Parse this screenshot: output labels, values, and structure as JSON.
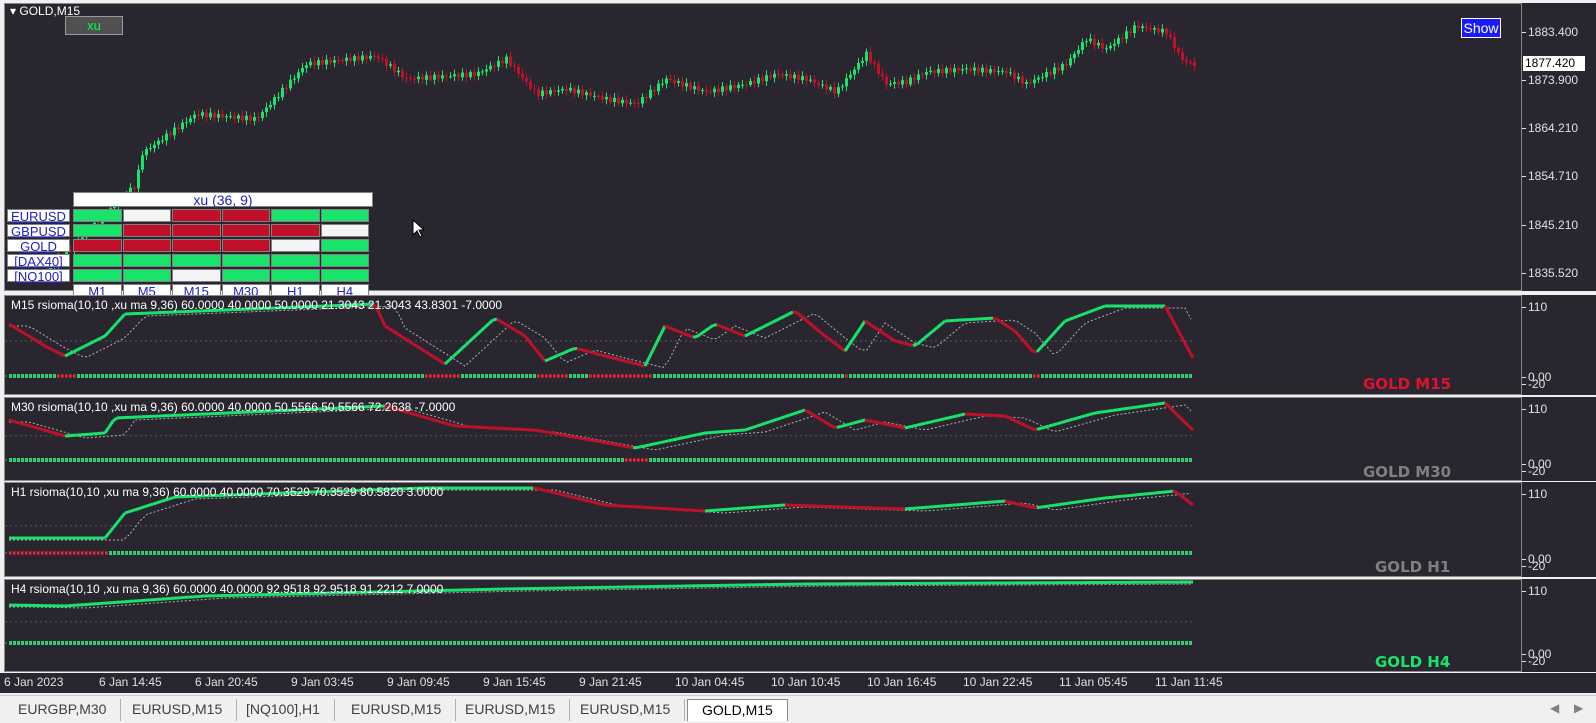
{
  "main_chart": {
    "symbol_label": "GOLD,M15",
    "xu_button": "xu",
    "show_button": "Show",
    "current_price": "1877.420",
    "price_ticks": [
      "1883.400",
      "1873.900",
      "1864.210",
      "1854.710",
      "1845.210",
      "1835.520"
    ]
  },
  "grid": {
    "title": "xu (36, 9)",
    "rows": [
      "EURUSD",
      "GBPUSD",
      "GOLD",
      "[DAX40]",
      "[NQ100]"
    ],
    "cols": [
      "M1",
      "M5",
      "M15",
      "M30",
      "H1",
      "H4"
    ],
    "cells": [
      [
        "green",
        "white",
        "red",
        "red",
        "green",
        "green"
      ],
      [
        "green",
        "red",
        "red",
        "red",
        "red",
        "white"
      ],
      [
        "red",
        "red",
        "red",
        "red",
        "white",
        "green"
      ],
      [
        "green",
        "green",
        "green",
        "green",
        "green",
        "green"
      ],
      [
        "green",
        "green",
        "white",
        "green",
        "green",
        "green"
      ]
    ],
    "colors": {
      "green": "#19e36b",
      "red": "#c0102a",
      "white": "#f4f4f4"
    }
  },
  "subwindows": [
    {
      "title": "M15  rsioma(10,10 ,xu ma 9,36) 60.0000 40.0000 50.0000 21.3043 21.3043 43.8301 -7.0000",
      "label": "GOLD M15",
      "label_color": "#e01030",
      "ticks": [
        "110",
        "0.00",
        "-20"
      ]
    },
    {
      "title": "M30  rsioma(10,10 ,xu ma 9,36) 60.0000 40.0000 50.5566 50.5566 72.2638 -7.0000",
      "label": "GOLD M30",
      "label_color": "#808080",
      "ticks": [
        "110",
        "0.00",
        "-20"
      ]
    },
    {
      "title": "H1  rsioma(10,10 ,xu ma 9,36) 60.0000 40.0000 70.3529 70.3529 80.5820 3.0000",
      "label": "GOLD H1",
      "label_color": "#808080",
      "ticks": [
        "110",
        "0.00",
        "-20"
      ]
    },
    {
      "title": "H4  rsioma(10,10 ,xu ma 9,36) 60.0000 40.0000 92.9518 92.9518 91.2212 7.0000",
      "label": "GOLD H4",
      "label_color": "#19e36b",
      "ticks": [
        "110",
        "0.00",
        "-20"
      ]
    }
  ],
  "time_ticks": [
    "6 Jan 2023",
    "6 Jan 14:45",
    "6 Jan 20:45",
    "9 Jan 03:45",
    "9 Jan 09:45",
    "9 Jan 15:45",
    "9 Jan 21:45",
    "10 Jan 04:45",
    "10 Jan 10:45",
    "10 Jan 16:45",
    "10 Jan 22:45",
    "11 Jan 05:45",
    "11 Jan 11:45"
  ],
  "tabs": [
    "EURGBP,M30",
    "EURUSD,M15",
    "[NQ100],H1",
    "EURUSD,M15",
    "EURUSD,M15",
    "EURUSD,M15",
    "GOLD,M15"
  ],
  "active_tab": "GOLD,M15",
  "icons": {
    "scroll_left": "triangle-left-icon",
    "scroll_right": "triangle-right-icon",
    "menu": "triangle-down-icon"
  },
  "colors": {
    "bull": "#19e36b",
    "bear": "#c0102a",
    "background": "#2a2630"
  }
}
